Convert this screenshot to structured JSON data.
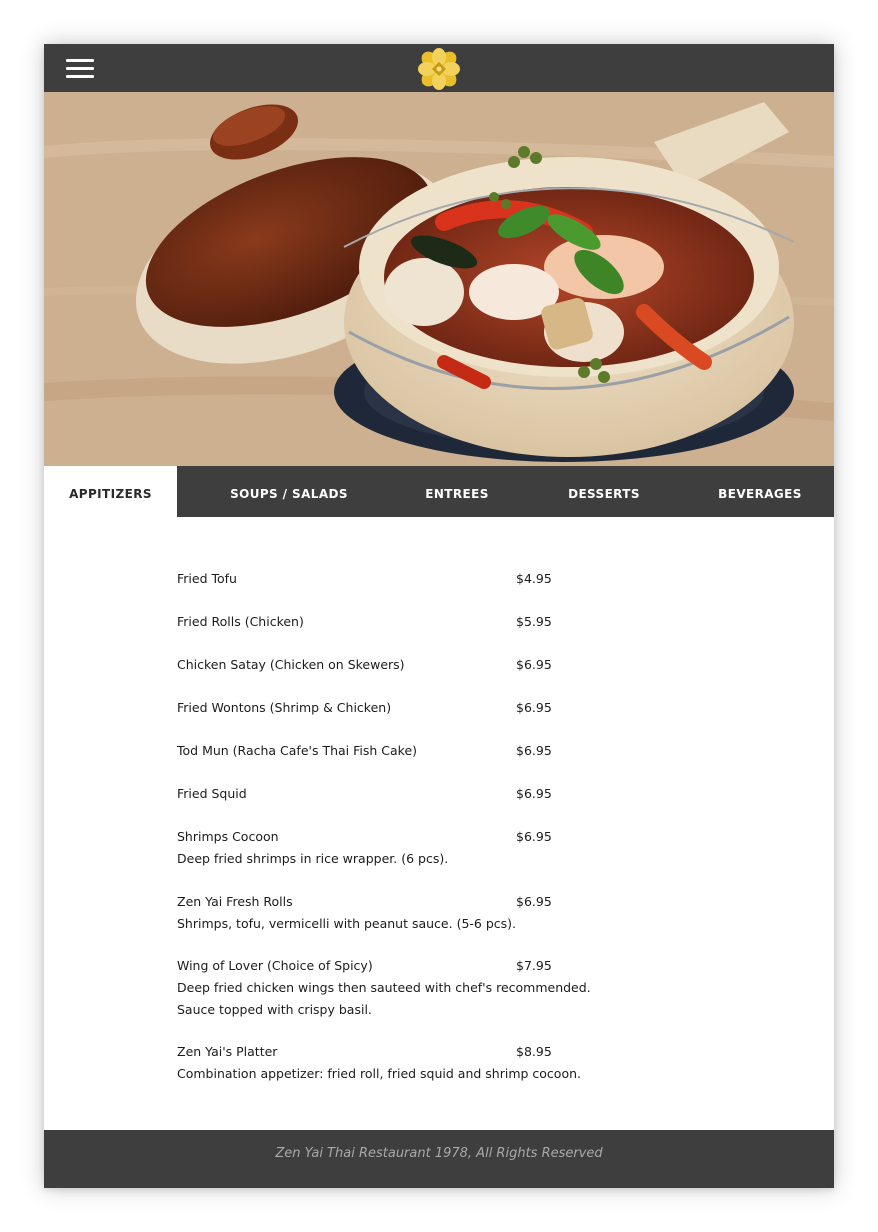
{
  "header": {
    "menu_icon": "hamburger-menu-icon",
    "logo_icon": "golden-flower-logo-icon",
    "colors": {
      "bar": "#3e3e3e",
      "logo_gold": "#e3b623"
    }
  },
  "hero": {
    "image": "clay-pot-seafood-dish-photo"
  },
  "tabs": [
    {
      "label": "APPITIZERS",
      "active": true
    },
    {
      "label": "SOUPS / SALADS",
      "active": false
    },
    {
      "label": "ENTREES",
      "active": false
    },
    {
      "label": "DESSERTS",
      "active": false
    },
    {
      "label": "BEVERAGES",
      "active": false
    }
  ],
  "menu": {
    "items": [
      {
        "name": "Fried Tofu",
        "price": "$4.95",
        "description": ""
      },
      {
        "name": "Fried Rolls (Chicken)",
        "price": "$5.95",
        "description": ""
      },
      {
        "name": "Chicken Satay (Chicken on Skewers)",
        "price": "$6.95",
        "description": ""
      },
      {
        "name": "Fried Wontons (Shrimp & Chicken)",
        "price": "$6.95",
        "description": ""
      },
      {
        "name": "Tod Mun (Racha Cafe's Thai Fish Cake)",
        "price": "$6.95",
        "description": ""
      },
      {
        "name": "Fried Squid",
        "price": "$6.95",
        "description": ""
      },
      {
        "name": "Shrimps Cocoon",
        "price": "$6.95",
        "description": "Deep fried shrimps in rice wrapper. (6 pcs)."
      },
      {
        "name": "Zen Yai Fresh Rolls",
        "price": "$6.95",
        "description": "Shrimps, tofu, vermicelli with peanut sauce. (5-6 pcs)."
      },
      {
        "name": "Wing of Lover (Choice of Spicy)",
        "price": "$7.95",
        "description": "Deep fried chicken wings then sauteed with chef's recommended.\nSauce topped with crispy basil."
      },
      {
        "name": "Zen Yai's Platter",
        "price": "$8.95",
        "description": "Combination appetizer: fried roll, fried squid and shrimp cocoon."
      }
    ]
  },
  "footer": {
    "text": "Zen Yai Thai Restaurant 1978, All Rights Reserved"
  }
}
